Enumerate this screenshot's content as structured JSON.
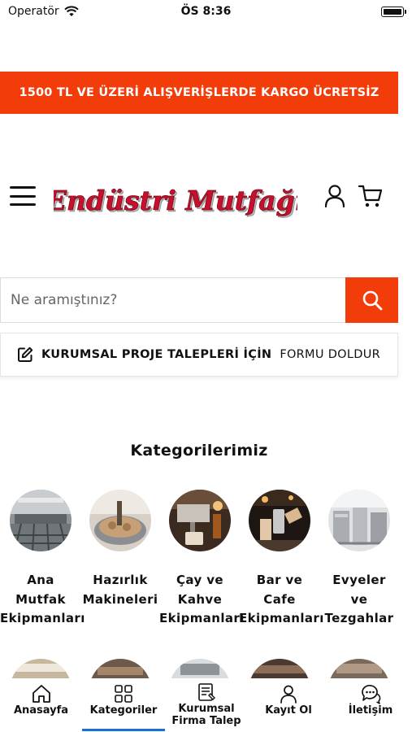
{
  "status_bar": {
    "carrier": "Operatör",
    "time": "ÖS 8:36"
  },
  "promo": {
    "text": "1500 TL VE ÜZERİ ALIŞVERİŞLERDE KARGO ÜCRETSİZ"
  },
  "header": {
    "logo_text": "Endüstri Mutfağı"
  },
  "search": {
    "placeholder": "Ne aramıştınız?"
  },
  "corporate": {
    "bold_text": "KURUMSAL PROJE TALEPLERİ İÇİN",
    "link_text": "FORMU DOLDUR"
  },
  "categories": {
    "title": "Kategorilerimiz",
    "items": [
      {
        "label": "Ana\nMutfak\nEkipmanları"
      },
      {
        "label": "Hazırlık\nMakineleri"
      },
      {
        "label": "Çay ve\nKahve\nEkipmanları"
      },
      {
        "label": "Bar ve\nCafe\nEkipmanları"
      },
      {
        "label": "Evyeler\nve\nTezgahlar"
      }
    ]
  },
  "tabs": [
    {
      "label": "Anasayfa",
      "icon": "home-icon"
    },
    {
      "label": "Kategoriler",
      "icon": "grid-icon"
    },
    {
      "label": "Kurumsal\nFirma Talep",
      "icon": "form-icon"
    },
    {
      "label": "Kayıt Ol",
      "icon": "user-icon"
    },
    {
      "label": "İletişim",
      "icon": "chat-icon"
    }
  ],
  "colors": {
    "accent": "#f23d0a",
    "active_tab": "#1a6fd6"
  }
}
